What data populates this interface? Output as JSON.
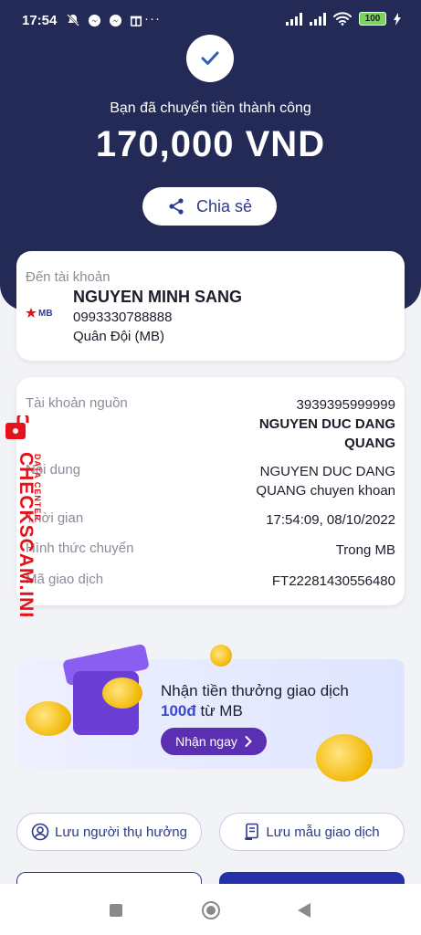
{
  "status_bar": {
    "time": "17:54",
    "more": "···",
    "battery": "100"
  },
  "result": {
    "headline": "Bạn đã chuyển tiền thành công",
    "amount": "170,000 VND",
    "share_label": "Chia sẻ"
  },
  "recipient": {
    "label": "Đến tài khoản",
    "bank_logo": "MB",
    "name": "NGUYEN MINH SANG",
    "account": "0993330788888",
    "bank": "Quân Đội (MB)"
  },
  "details": [
    {
      "key": "Tài khoản nguồn",
      "value_lines": [
        "3939395999999"
      ],
      "value_bold_lines": [
        "NGUYEN DUC DANG",
        "QUANG"
      ]
    },
    {
      "key": "Nội dung",
      "value_lines": [
        "NGUYEN DUC DANG",
        "QUANG chuyen khoan"
      ],
      "value_bold_lines": []
    },
    {
      "key": "Thời gian",
      "value_lines": [
        "17:54:09, 08/10/2022"
      ],
      "value_bold_lines": []
    },
    {
      "key": "Hình thức chuyển",
      "value_lines": [
        "Trong MB"
      ],
      "value_bold_lines": []
    },
    {
      "key": "Mã giao dịch",
      "value_lines": [
        "FT22281430556480"
      ],
      "value_bold_lines": []
    }
  ],
  "watermark": {
    "main": "CHECKSCAM.INFO",
    "sub": "DATA CENTER"
  },
  "promo": {
    "text_before": "Nhận tiền thưởng giao dịch ",
    "highlight": "100đ",
    "text_after": " từ MB",
    "button": "Nhận ngay"
  },
  "actions": {
    "save_beneficiary": "Lưu người thụ hưởng",
    "save_template": "Lưu mẫu giao dịch"
  },
  "colors": {
    "header_bg": "#232a55",
    "accent": "#2d3a8c",
    "promo_button": "#5a2fb2",
    "watermark": "#e3121b"
  }
}
